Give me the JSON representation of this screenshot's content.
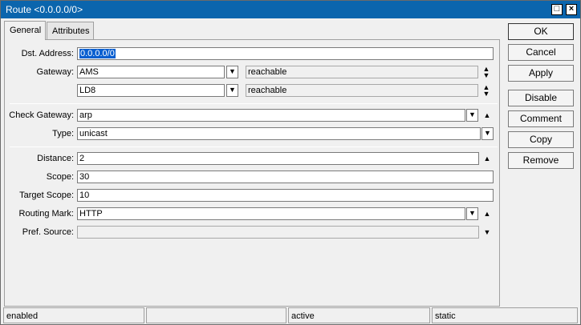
{
  "window": {
    "title": "Route <0.0.0.0/0>",
    "controls": {
      "restore": "□",
      "close": "×"
    }
  },
  "tabs": [
    "General",
    "Attributes"
  ],
  "form": {
    "dst_address": {
      "label": "Dst. Address:",
      "value": "0.0.0.0/0"
    },
    "gateway": {
      "label": "Gateway:",
      "entries": [
        {
          "value": "AMS",
          "status": "reachable"
        },
        {
          "value": "LD8",
          "status": "reachable"
        }
      ]
    },
    "check_gateway": {
      "label": "Check Gateway:",
      "value": "arp"
    },
    "type": {
      "label": "Type:",
      "value": "unicast"
    },
    "distance": {
      "label": "Distance:",
      "value": "2"
    },
    "scope": {
      "label": "Scope:",
      "value": "30"
    },
    "target_scope": {
      "label": "Target Scope:",
      "value": "10"
    },
    "routing_mark": {
      "label": "Routing Mark:",
      "value": "HTTP"
    },
    "pref_source": {
      "label": "Pref. Source:",
      "value": ""
    }
  },
  "buttons": {
    "ok": "OK",
    "cancel": "Cancel",
    "apply": "Apply",
    "disable": "Disable",
    "comment": "Comment",
    "copy": "Copy",
    "remove": "Remove"
  },
  "statusbar": [
    "enabled",
    "",
    "active",
    "static"
  ],
  "icons": {
    "dropdown": "dropdown-arrow-icon",
    "updown": "up-down-arrow-icon",
    "up": "up-arrow-icon",
    "down": "down-arrow-icon"
  },
  "colors": {
    "titlebar": "#0b65ad",
    "selection": "#0a5fd0"
  }
}
